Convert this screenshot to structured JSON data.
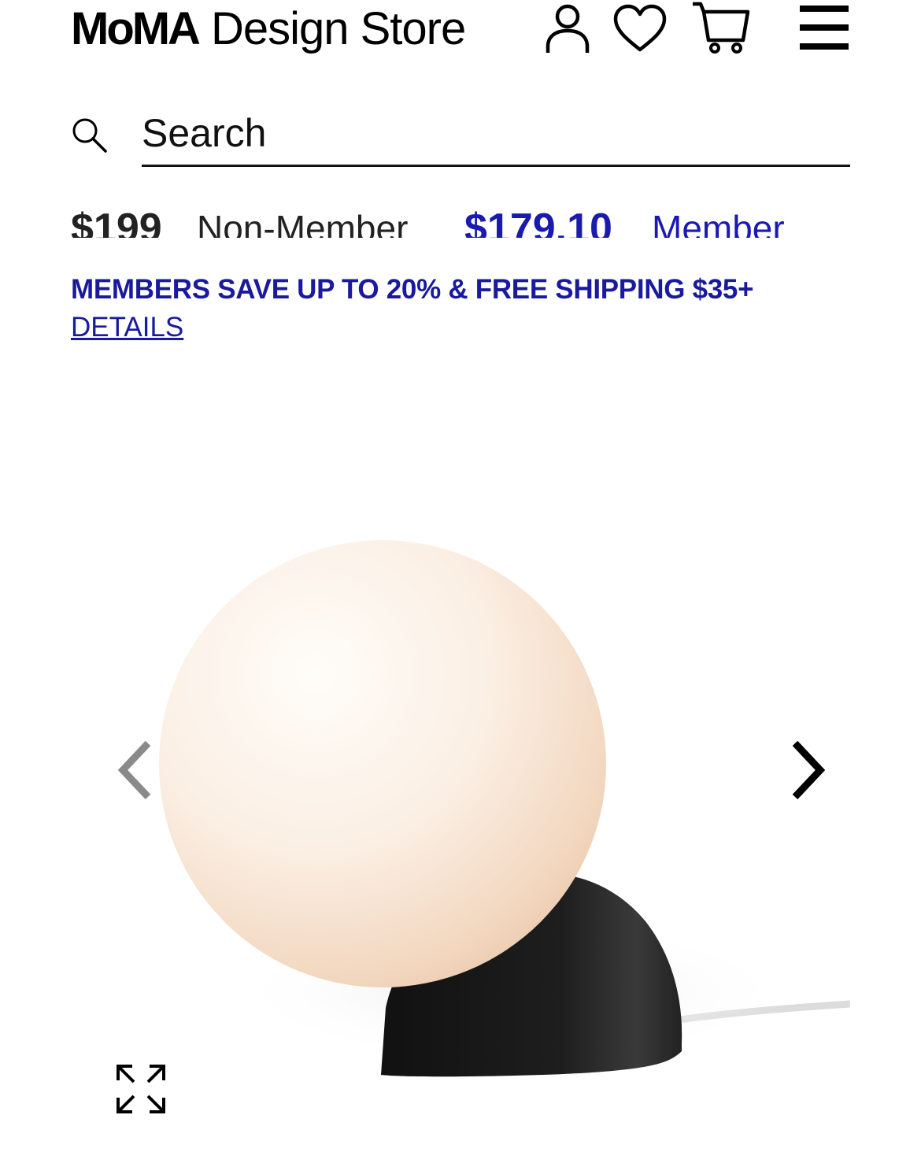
{
  "header": {
    "logo_primary": "MoMA",
    "logo_secondary": "Design Store",
    "icons": [
      "account-icon",
      "wishlist-heart-icon",
      "cart-icon",
      "menu-icon"
    ]
  },
  "search": {
    "placeholder": "Search"
  },
  "price": {
    "nonmember_value": "$199",
    "nonmember_label": "Non-Member",
    "member_value": "$179.10",
    "member_label": "Member"
  },
  "promo": {
    "text": "MEMBERS SAVE UP TO 20% & FREE SHIPPING $35+",
    "link_label": "DETAILS",
    "color": "#1a1a9e"
  },
  "carousel": {
    "icons": [
      "chevron-left-icon",
      "chevron-right-icon",
      "expand-icon"
    ]
  }
}
